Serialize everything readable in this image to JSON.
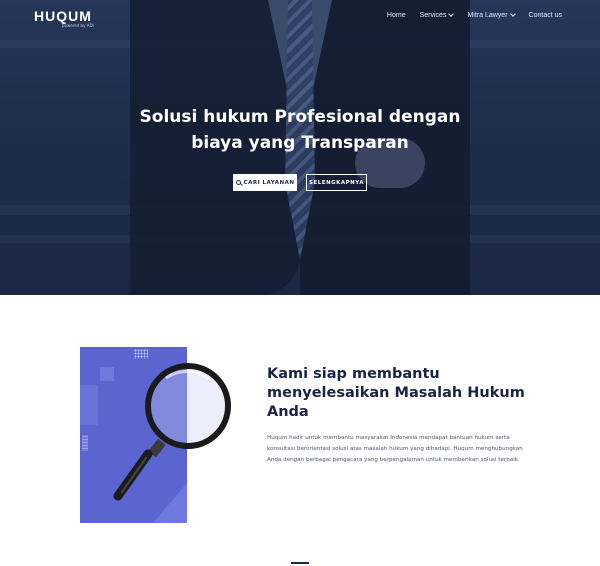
{
  "brand": {
    "logo_text": "HUQUM",
    "logo_sub": "powered by ADI"
  },
  "nav": {
    "items": [
      {
        "label": "Home",
        "has_dropdown": false
      },
      {
        "label": "Services",
        "has_dropdown": true
      },
      {
        "label": "Mitra Lawyer",
        "has_dropdown": true
      },
      {
        "label": "Contact us",
        "has_dropdown": false
      }
    ]
  },
  "hero": {
    "title_line1": "Solusi hukum Profesional dengan",
    "title_line2": "biaya yang Transparan",
    "primary_button": "CARI LAYANAN",
    "secondary_button": "SELENGKAPNYA"
  },
  "about": {
    "title_line1": "Kami siap membantu",
    "title_line2": "menyelesaikan Masalah Hukum",
    "title_line3": "Anda",
    "description": "Huqum hadir untuk membantu masyarakat Indonesia mendapat bantuan hukum serta konsultasi berorientasi solusi atas masalah hukum yang dihadapi. Huqum menghubungkan Anda dengan berbagai pengacara yang berpengalaman untuk memberikan solusi terbaik."
  },
  "colors": {
    "hero_overlay": "#1f2d4b",
    "illustration": "#5b64cf",
    "heading": "#1b2444",
    "body_text": "#4e566b"
  },
  "icons": [
    "search-icon",
    "chevron-down-icon",
    "magnifier-illustration"
  ]
}
